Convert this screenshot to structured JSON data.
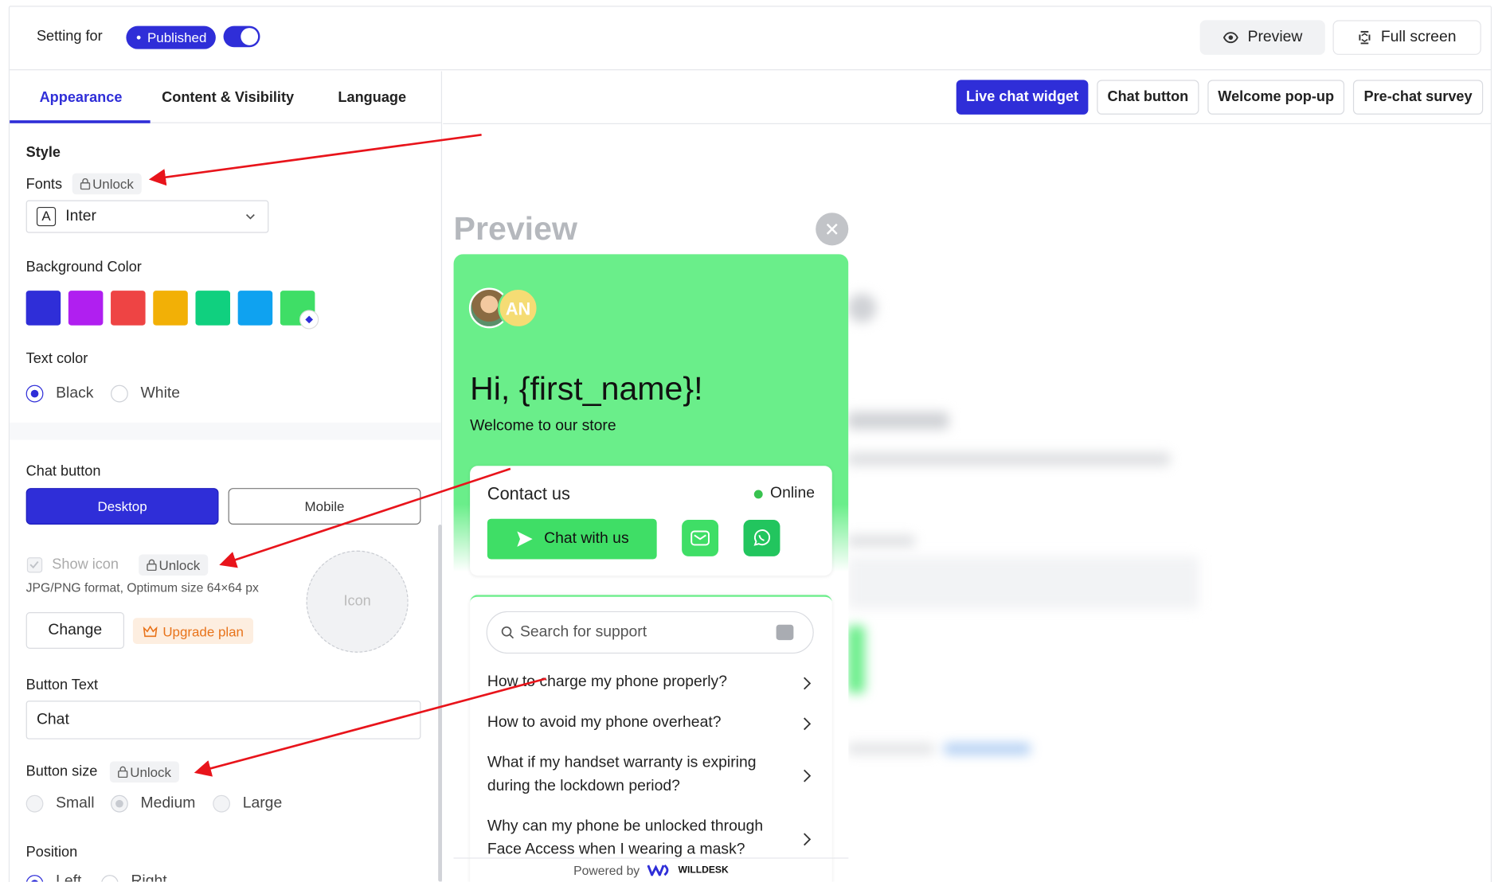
{
  "topbar": {
    "setting_for": "Setting for",
    "published": "Published",
    "preview_btn": "Preview",
    "fullscreen_btn": "Full screen"
  },
  "left_tabs": [
    "Appearance",
    "Content & Visibility",
    "Language"
  ],
  "style": {
    "heading": "Style",
    "fonts_label": "Fonts",
    "unlock": "Unlock",
    "font_value": "Inter",
    "bg_color_label": "Background Color",
    "swatches": [
      "#2f2ed8",
      "#b01ff0",
      "#ee4444",
      "#f2b006",
      "#10d07f",
      "#0fa2f0",
      "#3fde66"
    ],
    "text_color_label": "Text color",
    "text_color_options": [
      "Black",
      "White"
    ],
    "text_color_selected": "Black"
  },
  "chat_button": {
    "heading": "Chat button",
    "segments": [
      "Desktop",
      "Mobile"
    ],
    "show_icon": "Show icon",
    "unlock": "Unlock",
    "hint": "JPG/PNG format, Optimum size 64×64 px",
    "icon_placeholder": "Icon",
    "change": "Change",
    "upgrade": "Upgrade plan",
    "button_text_label": "Button Text",
    "button_text_value": "Chat",
    "button_size_label": "Button size",
    "size_options": [
      "Small",
      "Medium",
      "Large"
    ],
    "size_selected": "Medium",
    "position_label": "Position",
    "position_options": [
      "Left",
      "Right"
    ]
  },
  "right_tabs": [
    "Live chat widget",
    "Chat button",
    "Welcome pop-up",
    "Pre-chat survey"
  ],
  "preview": {
    "title": "Preview",
    "avatar_initials": "AN",
    "greeting": "Hi, {first_name}!",
    "welcome": "Welcome to our store",
    "contact_title": "Contact us",
    "status": "Online",
    "chat_with_us": "Chat with us",
    "search_placeholder": "Search for support",
    "faqs": [
      "How to charge my phone properly?",
      "How to avoid my phone overheat?",
      "What if my handset warranty is expiring during the lockdown period?",
      "Why can my phone be unlocked through Face Access when I wearing a mask?"
    ],
    "powered_by": "Powered by",
    "brand": "WILLDESK"
  },
  "colors": {
    "accent": "#2f2ed8",
    "widget_green": "#6aee8a",
    "button_green": "#3fde66",
    "arrow_red": "#e8141b"
  }
}
